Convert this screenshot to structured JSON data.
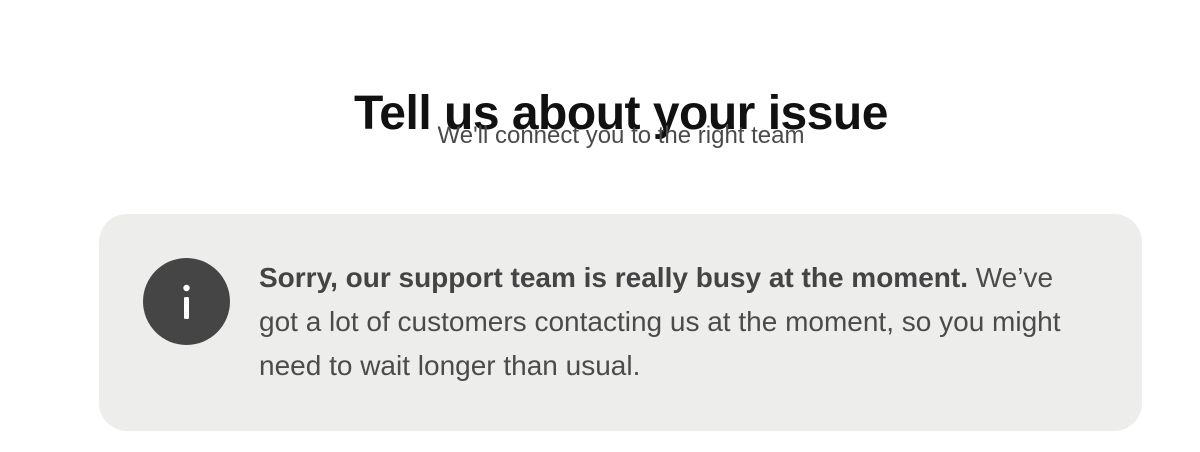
{
  "header": {
    "title": "Tell us about your issue",
    "subtitle": "We'll connect you to the right team"
  },
  "notice": {
    "icon": "info-icon",
    "headline": "Sorry, our support team is really busy at the moment.",
    "body": " We’ve got a lot of customers contacting us at the moment, so you might need to wait longer than usual."
  },
  "colors": {
    "card_background": "#edeeec",
    "icon_background": "#454545",
    "title_text": "#111111",
    "body_text": "#4b4b4b"
  }
}
